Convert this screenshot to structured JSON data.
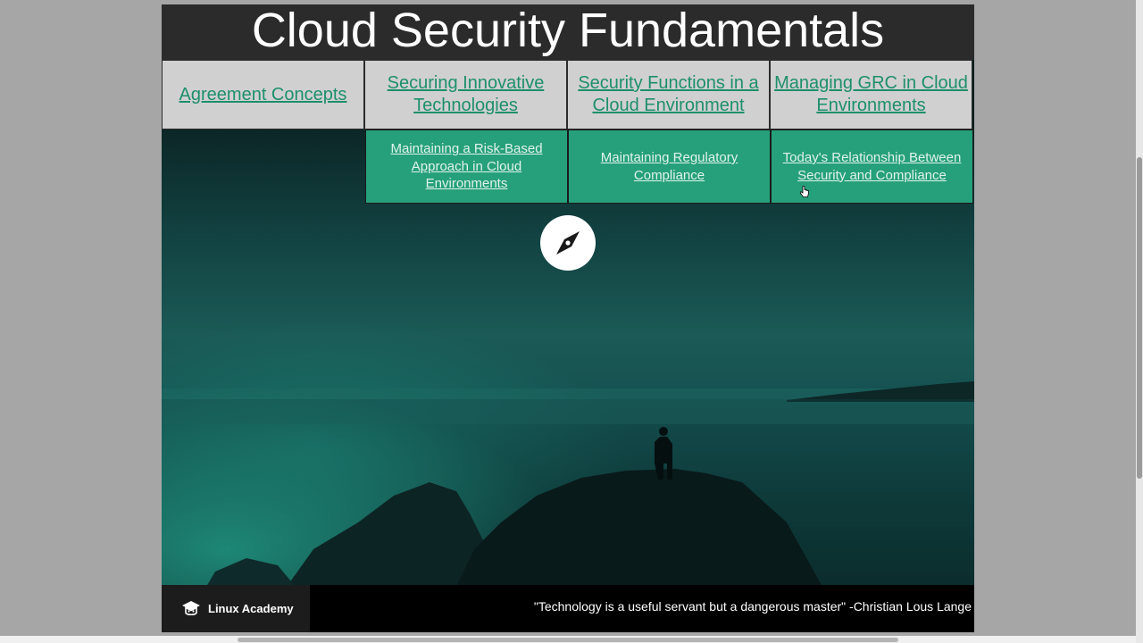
{
  "header": {
    "title": "Cloud Security Fundamentals"
  },
  "nav": {
    "items": [
      {
        "label": "Agreement Concepts"
      },
      {
        "label": "Securing Innovative Technologies"
      },
      {
        "label": "Security Functions in a Cloud Environment"
      },
      {
        "label": "Managing GRC in Cloud Environments"
      }
    ]
  },
  "subnav": {
    "items": [
      {
        "label": "Maintaining a Risk-Based Approach in Cloud Environments"
      },
      {
        "label": "Maintaining Regulatory Compliance"
      },
      {
        "label": "Today's Relationship Between Security and Compliance"
      }
    ]
  },
  "hero": {
    "icon": "compass-icon"
  },
  "footer": {
    "brand": "Linux Academy",
    "brand_icon": "graduation-cap-icon",
    "quote": "\"Technology is a useful servant but a dangerous master\" -Christian Lous Lange"
  },
  "colors": {
    "title_bg": "#2b2b2b",
    "nav_bg": "#d0d0d0",
    "link_green": "#1e8f6c",
    "subnav_bg": "#26a07a",
    "footer_bg": "#000000"
  }
}
